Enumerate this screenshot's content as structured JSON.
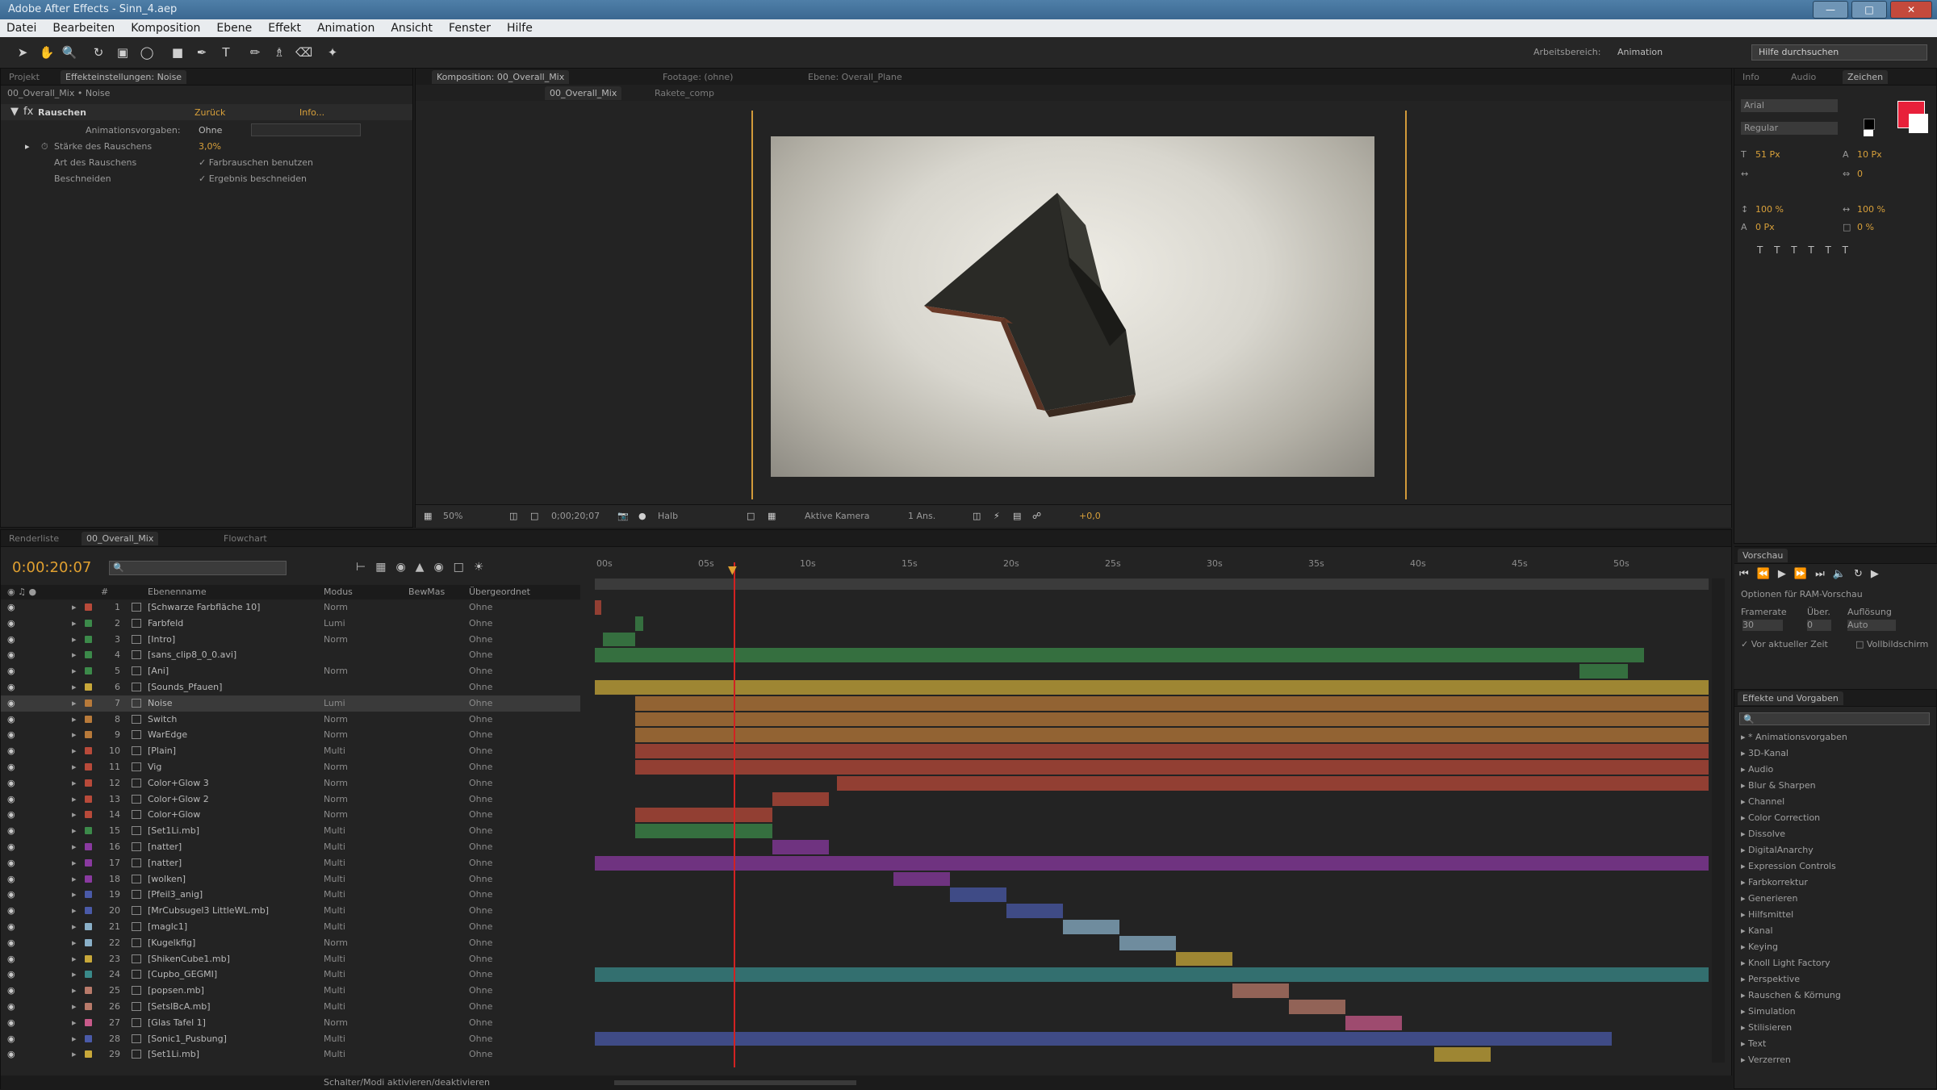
{
  "app": {
    "title": "Adobe After Effects - Sinn_4.aep"
  },
  "colors": {
    "accent": "#e0a030",
    "playhead": "#d22222",
    "swatch_fg": "#e8203a",
    "swatch_bg": "#ffffff"
  },
  "menu": [
    "Datei",
    "Bearbeiten",
    "Komposition",
    "Ebene",
    "Effekt",
    "Animation",
    "Ansicht",
    "Fenster",
    "Hilfe"
  ],
  "toolbar": {
    "workspace_label": "Arbeitsbereich:",
    "workspace_value": "Animation",
    "search_placeholder": "Hilfe durchsuchen"
  },
  "effect_controls": {
    "tabs": [
      "Projekt",
      "Effekteinstellungen: Noise"
    ],
    "breadcrumb": "00_Overall_Mix • Noise",
    "effect_name": "Rauschen",
    "reset_label": "Zurück",
    "about_label": "Info...",
    "props": [
      {
        "label": "Animationsvorgaben:",
        "value": "Ohne"
      },
      {
        "label": "Stärke des Rauschens",
        "value": "3,0%"
      },
      {
        "label": "Art des Rauschens",
        "value": "Farbrauschen benutzen"
      },
      {
        "label": "Beschneiden",
        "value": "Ergebnis beschneiden"
      }
    ]
  },
  "composition": {
    "tabs": [
      "Komposition: 00_Overall_Mix",
      "Footage: (ohne)",
      "Ebene: Overall_Plane"
    ],
    "sub_tabs": [
      "00_Overall_Mix",
      "Rakete_comp"
    ],
    "footer": {
      "zoom": "50%",
      "timecode": "0;00;20;07",
      "quality": "Halb",
      "camera": "Aktive Kamera",
      "views": "1 Ans.",
      "offset": "+0,0"
    }
  },
  "right_panel": {
    "tabs": [
      "Info",
      "Audio",
      "Zeichen"
    ],
    "font": "Arial",
    "style": "Regular",
    "size": "51 Px",
    "leading": "10 Px",
    "tracking": "0",
    "vscale": "100 %",
    "hscale": "100 %",
    "baseline": "0 Px",
    "tsume": "0 %"
  },
  "preview": {
    "title": "Vorschau",
    "options": [
      "Optionen für RAM-Vorschau",
      "Framerate",
      "Über.",
      "Auflösung",
      "Vor aktueller Zeit",
      "Vollbildschirm"
    ],
    "framerate": "30",
    "skip": "0",
    "resolution": "Auto"
  },
  "effects_presets": {
    "title": "Effekte und Vorgaben",
    "search_placeholder": "",
    "categories": [
      "* Animationsvorgaben",
      "3D-Kanal",
      "Audio",
      "Blur & Sharpen",
      "Channel",
      "Color Correction",
      "Dissolve",
      "DigitalAnarchy",
      "Expression Controls",
      "Farbkorrektur",
      "Generieren",
      "Hilfsmittel",
      "Kanal",
      "Keying",
      "Knoll Light Factory",
      "Perspektive",
      "Rauschen & Körnung",
      "Simulation",
      "Stilisieren",
      "Text",
      "Verzerren"
    ]
  },
  "timeline": {
    "tabs": [
      "Renderliste",
      "00_Overall_Mix",
      "Flowchart"
    ],
    "timecode": "0:00:20:07",
    "search_placeholder": "",
    "ruler": [
      "00s",
      "05s",
      "10s",
      "15s",
      "20s",
      "25s",
      "30s",
      "35s",
      "40s",
      "45s",
      "50s"
    ],
    "columns": {
      "name": "Ebenenname",
      "mode": "Modus",
      "trkmat": "BewMas",
      "parent": "Übergeordnet"
    },
    "footer": "Schalter/Modi aktivieren/deaktivieren",
    "layers": [
      {
        "num": "1",
        "name": "[Schwarze Farbfläche 10]",
        "mode": "Norm",
        "parent": "Ohne",
        "color": "#b84a3a"
      },
      {
        "num": "2",
        "name": "Farbfeld",
        "mode": "Lumi",
        "parent": "Ohne",
        "color": "#3c8a4a"
      },
      {
        "num": "3",
        "name": "[Intro]",
        "mode": "Norm",
        "parent": "Ohne",
        "color": "#3c8a4a"
      },
      {
        "num": "4",
        "name": "[sans_clip8_0_0.avi]",
        "mode": "",
        "parent": "Ohne",
        "color": "#3c8a4a"
      },
      {
        "num": "5",
        "name": "[Ani]",
        "mode": "Norm",
        "parent": "Ohne",
        "color": "#3c8a4a"
      },
      {
        "num": "6",
        "name": "[Sounds_Pfauen]",
        "mode": "",
        "parent": "Ohne",
        "color": "#c8a83a"
      },
      {
        "num": "7",
        "name": "Noise",
        "mode": "Lumi",
        "parent": "Ohne",
        "color": "#b87a3a"
      },
      {
        "num": "8",
        "name": "Switch",
        "mode": "Norm",
        "parent": "Ohne",
        "color": "#b87a3a"
      },
      {
        "num": "9",
        "name": "WarEdge",
        "mode": "Norm",
        "parent": "Ohne",
        "color": "#b87a3a"
      },
      {
        "num": "10",
        "name": "[Plain]",
        "mode": "Multi",
        "parent": "Ohne",
        "color": "#b84a3a"
      },
      {
        "num": "11",
        "name": "Vig",
        "mode": "Norm",
        "parent": "Ohne",
        "color": "#b84a3a"
      },
      {
        "num": "12",
        "name": "Color+Glow 3",
        "mode": "Norm",
        "parent": "Ohne",
        "color": "#b84a3a"
      },
      {
        "num": "13",
        "name": "Color+Glow 2",
        "mode": "Norm",
        "parent": "Ohne",
        "color": "#b84a3a"
      },
      {
        "num": "14",
        "name": "Color+Glow",
        "mode": "Norm",
        "parent": "Ohne",
        "color": "#b84a3a"
      },
      {
        "num": "15",
        "name": "[Set1Li.mb]",
        "mode": "Multi",
        "parent": "Ohne",
        "color": "#3c8a4a"
      },
      {
        "num": "16",
        "name": "[natter]",
        "mode": "Multi",
        "parent": "Ohne",
        "color": "#8a3aa0"
      },
      {
        "num": "17",
        "name": "[natter]",
        "mode": "Multi",
        "parent": "Ohne",
        "color": "#8a3aa0"
      },
      {
        "num": "18",
        "name": "[wolken]",
        "mode": "Multi",
        "parent": "Ohne",
        "color": "#8a3aa0"
      },
      {
        "num": "19",
        "name": "[Pfeil3_anig]",
        "mode": "Multi",
        "parent": "Ohne",
        "color": "#4a5aa8"
      },
      {
        "num": "20",
        "name": "[MrCubsugel3 LittleWL.mb]",
        "mode": "Multi",
        "parent": "Ohne",
        "color": "#4a5aa8"
      },
      {
        "num": "21",
        "name": "[maglc1]",
        "mode": "Multi",
        "parent": "Ohne",
        "color": "#8ab0c8"
      },
      {
        "num": "22",
        "name": "[Kugelkfig]",
        "mode": "Norm",
        "parent": "Ohne",
        "color": "#8ab0c8"
      },
      {
        "num": "23",
        "name": "[ShikenCube1.mb]",
        "mode": "Multi",
        "parent": "Ohne",
        "color": "#c8a83a"
      },
      {
        "num": "24",
        "name": "[Cupbo_GEGMI]",
        "mode": "Multi",
        "parent": "Ohne",
        "color": "#3a8a8a"
      },
      {
        "num": "25",
        "name": "[popsen.mb]",
        "mode": "Multi",
        "parent": "Ohne",
        "color": "#b87a6a"
      },
      {
        "num": "26",
        "name": "[SetslBcA.mb]",
        "mode": "Multi",
        "parent": "Ohne",
        "color": "#b87a6a"
      },
      {
        "num": "27",
        "name": "[Glas Tafel 1]",
        "mode": "Norm",
        "parent": "Ohne",
        "color": "#c85a8a"
      },
      {
        "num": "28",
        "name": "[Sonic1_Pusbung]",
        "mode": "Multi",
        "parent": "Ohne",
        "color": "#4a5aa8"
      },
      {
        "num": "29",
        "name": "[Set1Li.mb]",
        "mode": "Multi",
        "parent": "Ohne",
        "color": "#c8a83a"
      }
    ]
  }
}
